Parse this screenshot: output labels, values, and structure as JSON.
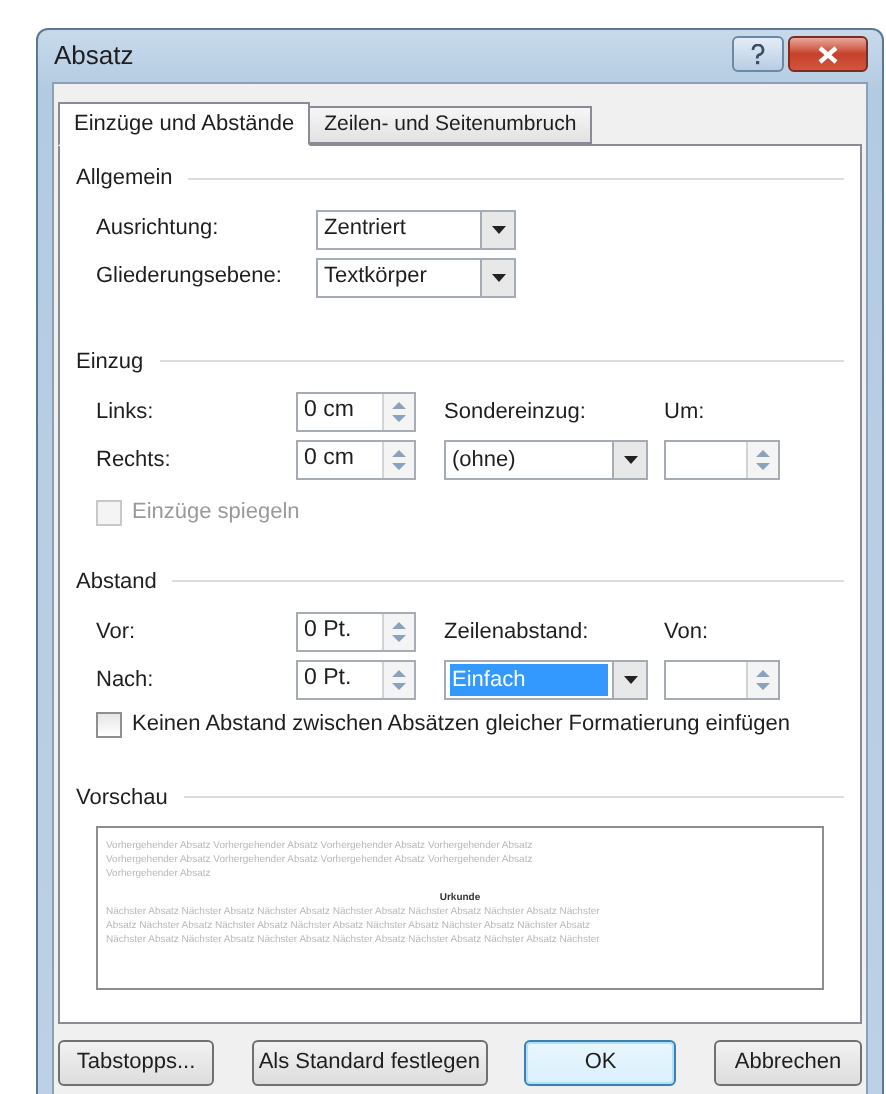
{
  "window": {
    "title": "Absatz"
  },
  "tabs": [
    {
      "label": "Einzüge und Abstände",
      "selected": true
    },
    {
      "label": "Zeilen- und Seitenumbruch",
      "selected": false
    }
  ],
  "general": {
    "title": "Allgemein",
    "fields": [
      {
        "label": "Ausrichtung:",
        "value": "Zentriert"
      },
      {
        "label": "Gliederungsebene:",
        "value": "Textkörper"
      }
    ]
  },
  "indent": {
    "title": "Einzug",
    "left": {
      "label": "Links:",
      "value": "0 cm"
    },
    "right": {
      "label": "Rechts:",
      "value": "0 cm"
    },
    "special": {
      "label": "Sondereinzug:",
      "value": "(ohne)"
    },
    "by": {
      "label": "Um:"
    },
    "mirror": {
      "label": "Einzüge spiegeln",
      "checked": false,
      "disabled": true
    }
  },
  "spacing": {
    "title": "Abstand",
    "before": {
      "label": "Vor:",
      "value": "0 Pt."
    },
    "after": {
      "label": "Nach:",
      "value": "0 Pt."
    },
    "line_spacing": {
      "label": "Zeilenabstand:",
      "value": "Einfach",
      "selected": true
    },
    "at": {
      "label": "Von:"
    },
    "no_space": {
      "label": "Keinen Abstand zwischen Absätzen gleicher Formatierung einfügen",
      "checked": false,
      "disabled": false
    }
  },
  "preview": {
    "title": "Vorschau",
    "before_lines": [
      "Vorhergehender Absatz Vorhergehender Absatz Vorhergehender Absatz Vorhergehender Absatz",
      "Vorhergehender Absatz Vorhergehender Absatz Vorhergehender Absatz Vorhergehender Absatz",
      "Vorhergehender Absatz"
    ],
    "sample": "Urkunde",
    "after_lines": [
      "Nächster Absatz Nächster Absatz Nächster Absatz Nächster Absatz Nächster Absatz Nächster Absatz Nächster",
      "Absatz Nächster Absatz Nächster Absatz Nächster Absatz Nächster Absatz Nächster Absatz Nächster Absatz",
      "Nächster Absatz Nächster Absatz Nächster Absatz Nächster Absatz Nächster Absatz Nächster Absatz Nächster"
    ]
  },
  "buttons": [
    {
      "label": "Tabstopps...",
      "default": false
    },
    {
      "label": "Als Standard festlegen",
      "default": false
    },
    {
      "label": "OK",
      "default": true
    },
    {
      "label": "Abbrechen",
      "default": false
    }
  ]
}
